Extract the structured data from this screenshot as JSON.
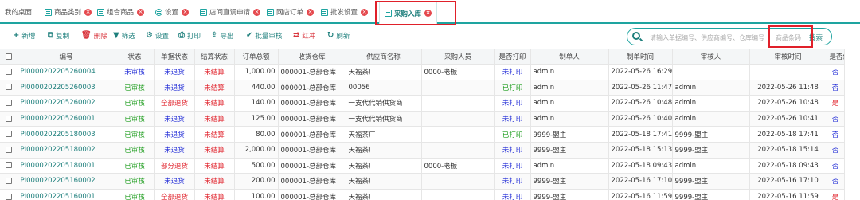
{
  "tabs": [
    {
      "label": "我的桌面"
    },
    {
      "label": "商品类别"
    },
    {
      "label": "组合商品"
    },
    {
      "label": "设置"
    },
    {
      "label": "店间直调申请"
    },
    {
      "label": "网店订单"
    },
    {
      "label": "批发设置"
    },
    {
      "label": "采购入库"
    }
  ],
  "toolbar": {
    "add": "新增",
    "copy": "复制",
    "delete": "删除",
    "filter": "筛选",
    "settings": "设置",
    "print": "打印",
    "export": "导出",
    "batch_review": "批量审核",
    "red_flush": "红冲",
    "refresh": "刷新"
  },
  "search": {
    "placeholder": "请输入单据编号、供应商编号、仓库编号",
    "barcode_placeholder": "商品条码",
    "button": "搜索"
  },
  "columns": [
    "编号",
    "状态",
    "单据状态",
    "结算状态",
    "订单总额",
    "收货仓库",
    "供应商名称",
    "采购人员",
    "是否打印",
    "制单人",
    "制单时间",
    "审核人",
    "审核时间",
    "是否红"
  ],
  "rows": [
    {
      "no": "PI0000202205260004",
      "status": "未审核",
      "status_color": "b",
      "doc": "未退货",
      "doc_color": "b",
      "settle": "未结算",
      "settle_color": "r",
      "total": "1,000.00",
      "wh": "000001-总部仓库",
      "supplier": "天福茶厂",
      "buyer": "0000-老板",
      "printed": "未打印",
      "printed_color": "b",
      "maker": "admin",
      "make_time": "2022-05-26 16:29",
      "reviewer": "",
      "review_time": "",
      "red": "否",
      "red_color": "b"
    },
    {
      "no": "PI0000202205260003",
      "status": "已审核",
      "status_color": "g",
      "doc": "未退货",
      "doc_color": "b",
      "settle": "未结算",
      "settle_color": "r",
      "total": "440.00",
      "wh": "000001-总部仓库",
      "supplier": "00056",
      "buyer": "",
      "printed": "已打印",
      "printed_color": "g",
      "maker": "admin",
      "make_time": "2022-05-26 11:47",
      "reviewer": "admin",
      "review_time": "2022-05-26 11:48",
      "red": "否",
      "red_color": "b"
    },
    {
      "no": "PI0000202205260002",
      "status": "已审核",
      "status_color": "g",
      "doc": "全部退货",
      "doc_color": "r",
      "settle": "未结算",
      "settle_color": "r",
      "total": "140.00",
      "wh": "000001-总部仓库",
      "supplier": "一支代代销供货商",
      "buyer": "",
      "printed": "未打印",
      "printed_color": "b",
      "maker": "admin",
      "make_time": "2022-05-26 10:48",
      "reviewer": "admin",
      "review_time": "2022-05-26 10:48",
      "red": "是",
      "red_color": "r"
    },
    {
      "no": "PI0000202205260001",
      "status": "已审核",
      "status_color": "g",
      "doc": "未退货",
      "doc_color": "b",
      "settle": "未结算",
      "settle_color": "r",
      "total": "125.00",
      "wh": "000001-总部仓库",
      "supplier": "一支代代销供货商",
      "buyer": "",
      "printed": "未打印",
      "printed_color": "b",
      "maker": "admin",
      "make_time": "2022-05-26 10:40",
      "reviewer": "admin",
      "review_time": "2022-05-26 10:41",
      "red": "否",
      "red_color": "b"
    },
    {
      "no": "PI0000202205180003",
      "status": "已审核",
      "status_color": "g",
      "doc": "未退货",
      "doc_color": "b",
      "settle": "未结算",
      "settle_color": "r",
      "total": "80.00",
      "wh": "000001-总部仓库",
      "supplier": "天福茶厂",
      "buyer": "",
      "printed": "已打印",
      "printed_color": "g",
      "maker": "9999-盟主",
      "make_time": "2022-05-18 17:41",
      "reviewer": "9999-盟主",
      "review_time": "2022-05-18 17:41",
      "red": "否",
      "red_color": "b"
    },
    {
      "no": "PI0000202205180002",
      "status": "已审核",
      "status_color": "g",
      "doc": "未退货",
      "doc_color": "b",
      "settle": "未结算",
      "settle_color": "r",
      "total": "2,000.00",
      "wh": "000001-总部仓库",
      "supplier": "天福茶厂",
      "buyer": "",
      "printed": "未打印",
      "printed_color": "b",
      "maker": "9999-盟主",
      "make_time": "2022-05-18 15:13",
      "reviewer": "9999-盟主",
      "review_time": "2022-05-18 15:14",
      "red": "否",
      "red_color": "b"
    },
    {
      "no": "PI0000202205180001",
      "status": "已审核",
      "status_color": "g",
      "doc": "部分退货",
      "doc_color": "r",
      "settle": "未结算",
      "settle_color": "r",
      "total": "500.00",
      "wh": "000001-总部仓库",
      "supplier": "天福茶厂",
      "buyer": "0000-老板",
      "printed": "未打印",
      "printed_color": "b",
      "maker": "admin",
      "make_time": "2022-05-18 09:43",
      "reviewer": "admin",
      "review_time": "2022-05-18 09:43",
      "red": "否",
      "red_color": "b"
    },
    {
      "no": "PI0000202205160002",
      "status": "已审核",
      "status_color": "g",
      "doc": "未退货",
      "doc_color": "b",
      "settle": "未结算",
      "settle_color": "r",
      "total": "200.00",
      "wh": "000001-总部仓库",
      "supplier": "天福茶厂",
      "buyer": "",
      "printed": "未打印",
      "printed_color": "b",
      "maker": "9999-盟主",
      "make_time": "2022-05-16 17:10",
      "reviewer": "9999-盟主",
      "review_time": "2022-05-16 17:10",
      "red": "否",
      "red_color": "b"
    },
    {
      "no": "PI0000202205160001",
      "status": "已审核",
      "status_color": "g",
      "doc": "全部退货",
      "doc_color": "r",
      "settle": "未结算",
      "settle_color": "r",
      "total": "100.00",
      "wh": "000001-总部仓库",
      "supplier": "天福茶厂",
      "buyer": "",
      "printed": "未打印",
      "printed_color": "b",
      "maker": "9999-盟主",
      "make_time": "2022-05-16 11:59",
      "reviewer": "9999-盟主",
      "review_time": "2022-05-16 11:59",
      "red": "是",
      "red_color": "r"
    }
  ]
}
